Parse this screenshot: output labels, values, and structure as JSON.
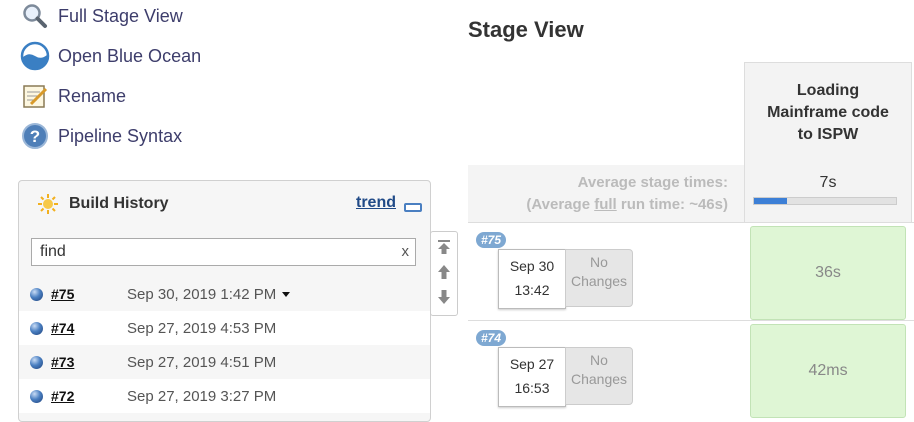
{
  "sidebar": {
    "items": [
      {
        "label": "Full Stage View",
        "icon": "magnifier-icon"
      },
      {
        "label": "Open Blue Ocean",
        "icon": "blue-ocean-icon"
      },
      {
        "label": "Rename",
        "icon": "notepad-icon"
      },
      {
        "label": "Pipeline Syntax",
        "icon": "help-icon"
      }
    ]
  },
  "build_history": {
    "title": "Build History",
    "trend_label": "trend",
    "search": {
      "value": "find",
      "clear_label": "x"
    },
    "builds": [
      {
        "number": "#75",
        "date": "Sep 30, 2019 1:42 PM"
      },
      {
        "number": "#74",
        "date": "Sep 27, 2019 4:53 PM"
      },
      {
        "number": "#73",
        "date": "Sep 27, 2019 4:51 PM"
      },
      {
        "number": "#72",
        "date": "Sep 27, 2019 3:27 PM"
      }
    ]
  },
  "stage_view": {
    "title": "Stage View",
    "avg_line1": "Average stage times:",
    "avg_line2_prefix": "(Average ",
    "avg_line2_full": "full",
    "avg_line2_suffix": " run time: ~46s)",
    "stage_name": "Loading Mainframe code to ISPW",
    "stage_avg_time": "7s",
    "stage_avg_progress_fraction": 0.23,
    "runs": [
      {
        "tag": "#75",
        "date": "Sep 30",
        "time": "13:42",
        "changes": "No Changes",
        "duration": "36s"
      },
      {
        "tag": "#74",
        "date": "Sep 27",
        "time": "16:53",
        "changes": "No Changes",
        "duration": "42ms"
      }
    ]
  },
  "colors": {
    "link": "#3d3d6b",
    "success_cell": "#dff6d5",
    "build_tag": "#7ea8d2",
    "accent_blue": "#3c7fd6"
  }
}
